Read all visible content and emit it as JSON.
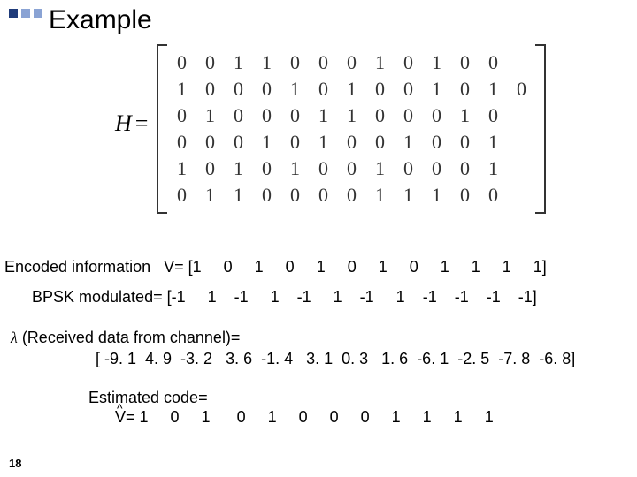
{
  "title": "Example",
  "page_number": "18",
  "matrix_label": "H",
  "matrix_eq": "=",
  "matrix": [
    [
      "0",
      "0",
      "1",
      "1",
      "0",
      "0",
      "0",
      "1",
      "0",
      "1",
      "0",
      "0"
    ],
    [
      "1",
      "0",
      "0",
      "0",
      "1",
      "0",
      "1",
      "0",
      "0",
      "1",
      "0",
      "1",
      "0"
    ],
    [
      "0",
      "1",
      "0",
      "0",
      "0",
      "1",
      "1",
      "0",
      "0",
      "0",
      "1",
      "0"
    ],
    [
      "0",
      "0",
      "0",
      "1",
      "0",
      "1",
      "0",
      "0",
      "1",
      "0",
      "0",
      "1"
    ],
    [
      "1",
      "0",
      "1",
      "0",
      "1",
      "0",
      "0",
      "1",
      "0",
      "0",
      "0",
      "1"
    ],
    [
      "0",
      "1",
      "1",
      "0",
      "0",
      "0",
      "0",
      "1",
      "1",
      "1",
      "0",
      "0"
    ]
  ],
  "encoded_label": "Encoded information   V= [1     0     1     0     1     0     1     0     1     1     1     1]",
  "bpsk_label": "BPSK modulated= [-1     1    -1     1    -1     1    -1     1    -1    -1    -1    -1]",
  "lambda_line1": "λ (Received data from channel)=",
  "lambda_line2": "[ -9. 1  4. 9  -3. 2   3. 6  -1. 4   3. 1  0. 3   1. 6  -6. 1  -2. 5  -7. 8  -6. 8]",
  "est_line1": "Estimated code=",
  "est_line2": "V= 1     0     1      0     1     0     0     0     1     1     1     1",
  "hat": "^"
}
